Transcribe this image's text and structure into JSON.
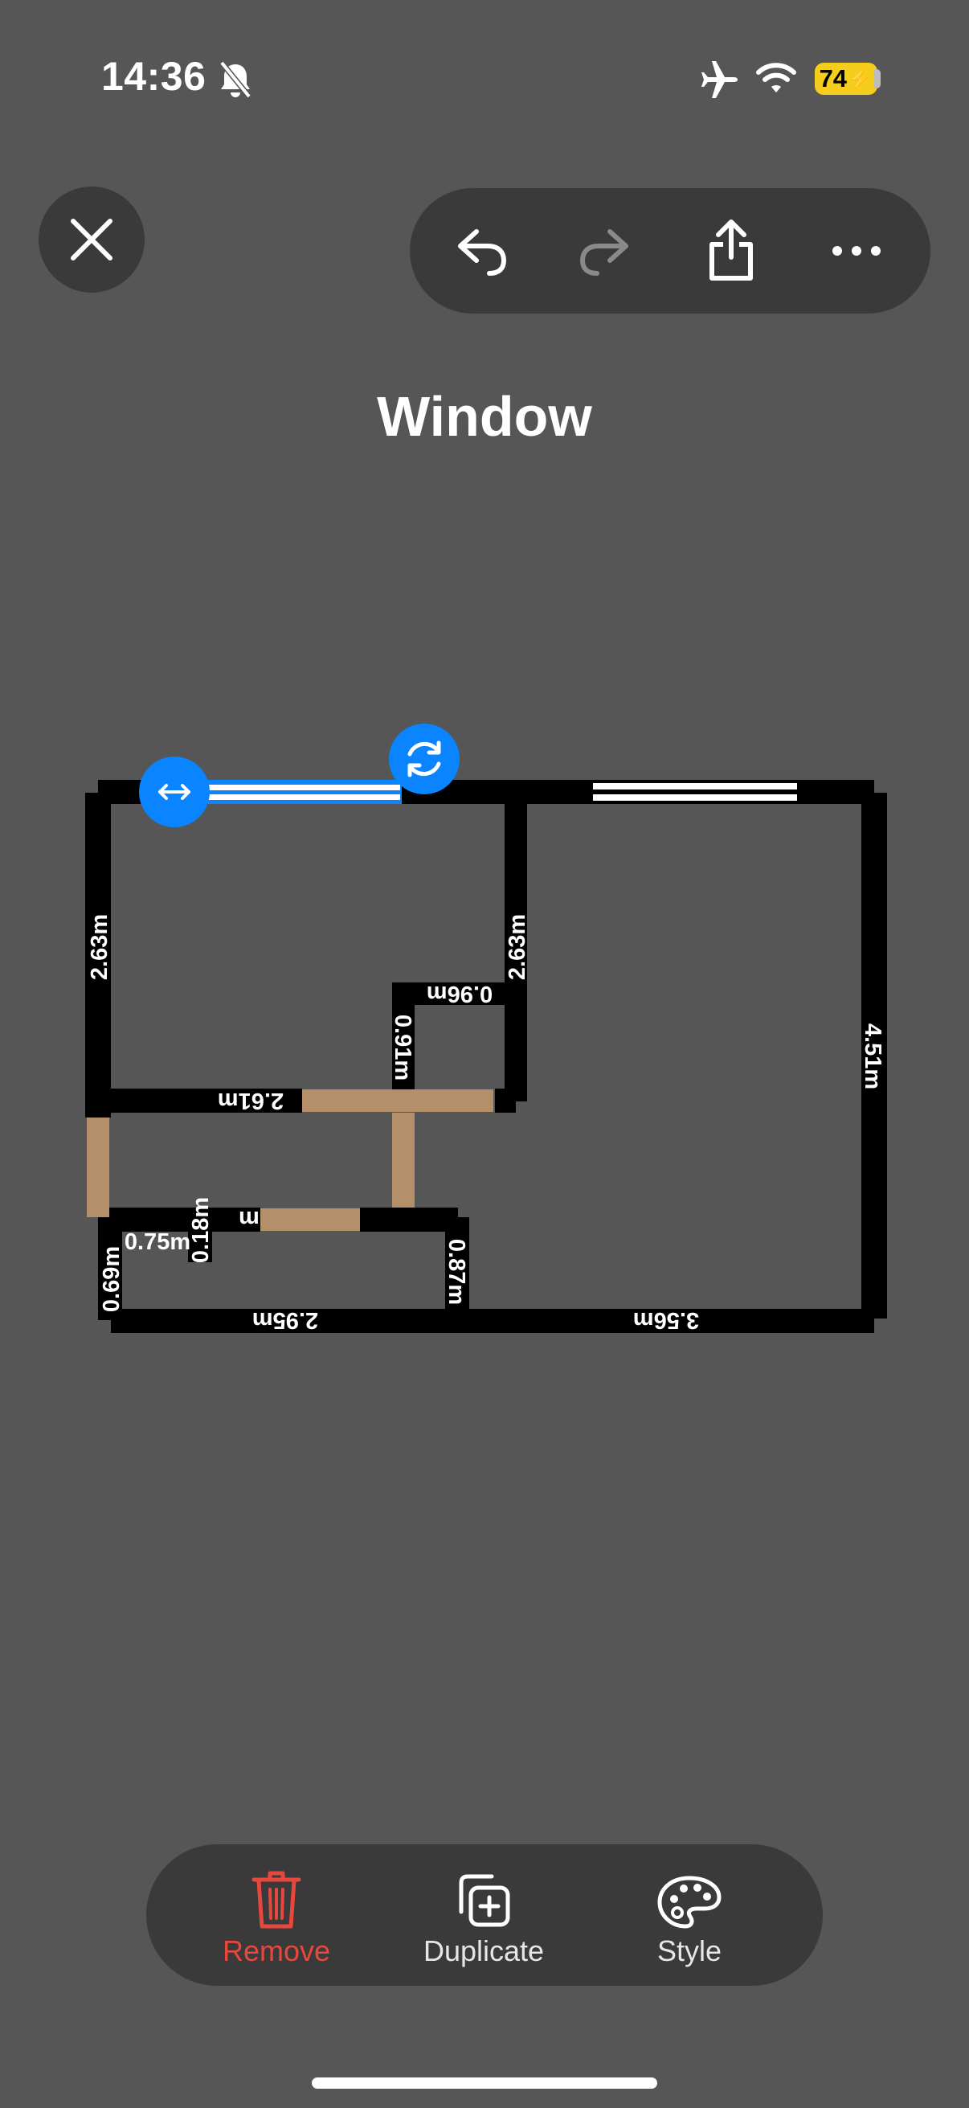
{
  "status_bar": {
    "time": "14:36",
    "battery": "74"
  },
  "page": {
    "title": "Window"
  },
  "toolbar": {
    "close": "close-icon",
    "undo": "undo-icon",
    "redo": "redo-icon",
    "share": "share-icon",
    "more": "more-icon"
  },
  "floor_plan": {
    "measurements": [
      "2.63m",
      "2.63m",
      "0.96m",
      "0.91m",
      "2.61m",
      "4.51m",
      "0.75m",
      "0.18m",
      "m",
      "0.69m",
      "0.87m",
      "2.95m",
      "3.56m"
    ]
  },
  "bottom_bar": {
    "remove_label": "Remove",
    "duplicate_label": "Duplicate",
    "style_label": "Style",
    "remove_color": "#e8473e"
  },
  "colors": {
    "background": "#565656",
    "panel": "#3a3a3a",
    "accent": "#0a84ff",
    "door": "#b38f6a",
    "wall": "#000000",
    "battery": "#f5cd1c"
  }
}
